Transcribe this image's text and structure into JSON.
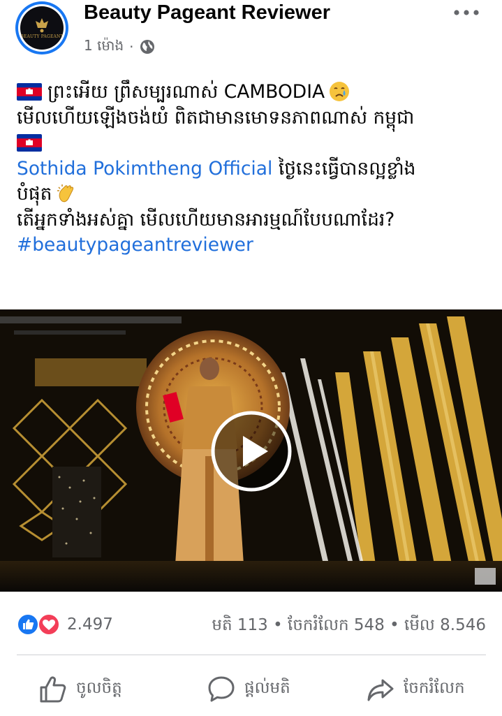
{
  "post": {
    "page_name": "Beauty Pageant Reviewer",
    "logo_text": "BEAUTY PAGEANT",
    "time": "1 ម៉ោង",
    "time_separator": "·",
    "text": {
      "line1": "ព្រះអើយ ព្រឹសម្បរណាស់ CAMBODIA",
      "line2": "មើលហើយឡើងចង់យំ ពិតជាមានមោទនភាពណាស់ កម្ពុជា",
      "mention": "Sothida Pokimtheng Official",
      "line3_rest": " ថ្ងៃនេះធ្វើបានល្អខ្លាំង",
      "line4": "បំផុត",
      "line5": "តើអ្នកទាំងអស់គ្នា មើលហើយមានអារម្មណ៍បែបណាដែរ?",
      "hashtag": "#beautypageantreviewer"
    },
    "icons": {
      "more": "more-horizontal-icon",
      "globe": "globe-icon",
      "flag": "cambodia-flag-emoji",
      "crying": "sad-relieved-face-emoji",
      "clap": "clapping-hands-emoji",
      "play": "play-icon",
      "like_reaction": "like-reaction-icon",
      "love_reaction": "love-reaction-icon",
      "like": "thumbs-up-icon",
      "comment": "comment-icon",
      "share": "share-icon"
    }
  },
  "stats": {
    "reactions": "2.497",
    "comments": "មតិ 113",
    "shares": "ចែករំលែក 548",
    "views": "មើល 8.546",
    "separator": "•"
  },
  "actions": {
    "like": "ចូលចិត្ត",
    "comment": "ផ្ដល់មតិ",
    "share": "ចែករំលែក"
  },
  "colors": {
    "brand_blue": "#1877f2",
    "link": "#216fdb",
    "secondary_text": "#65676b",
    "love_red": "#f33e58",
    "stage_gold": "#d4a63a"
  }
}
